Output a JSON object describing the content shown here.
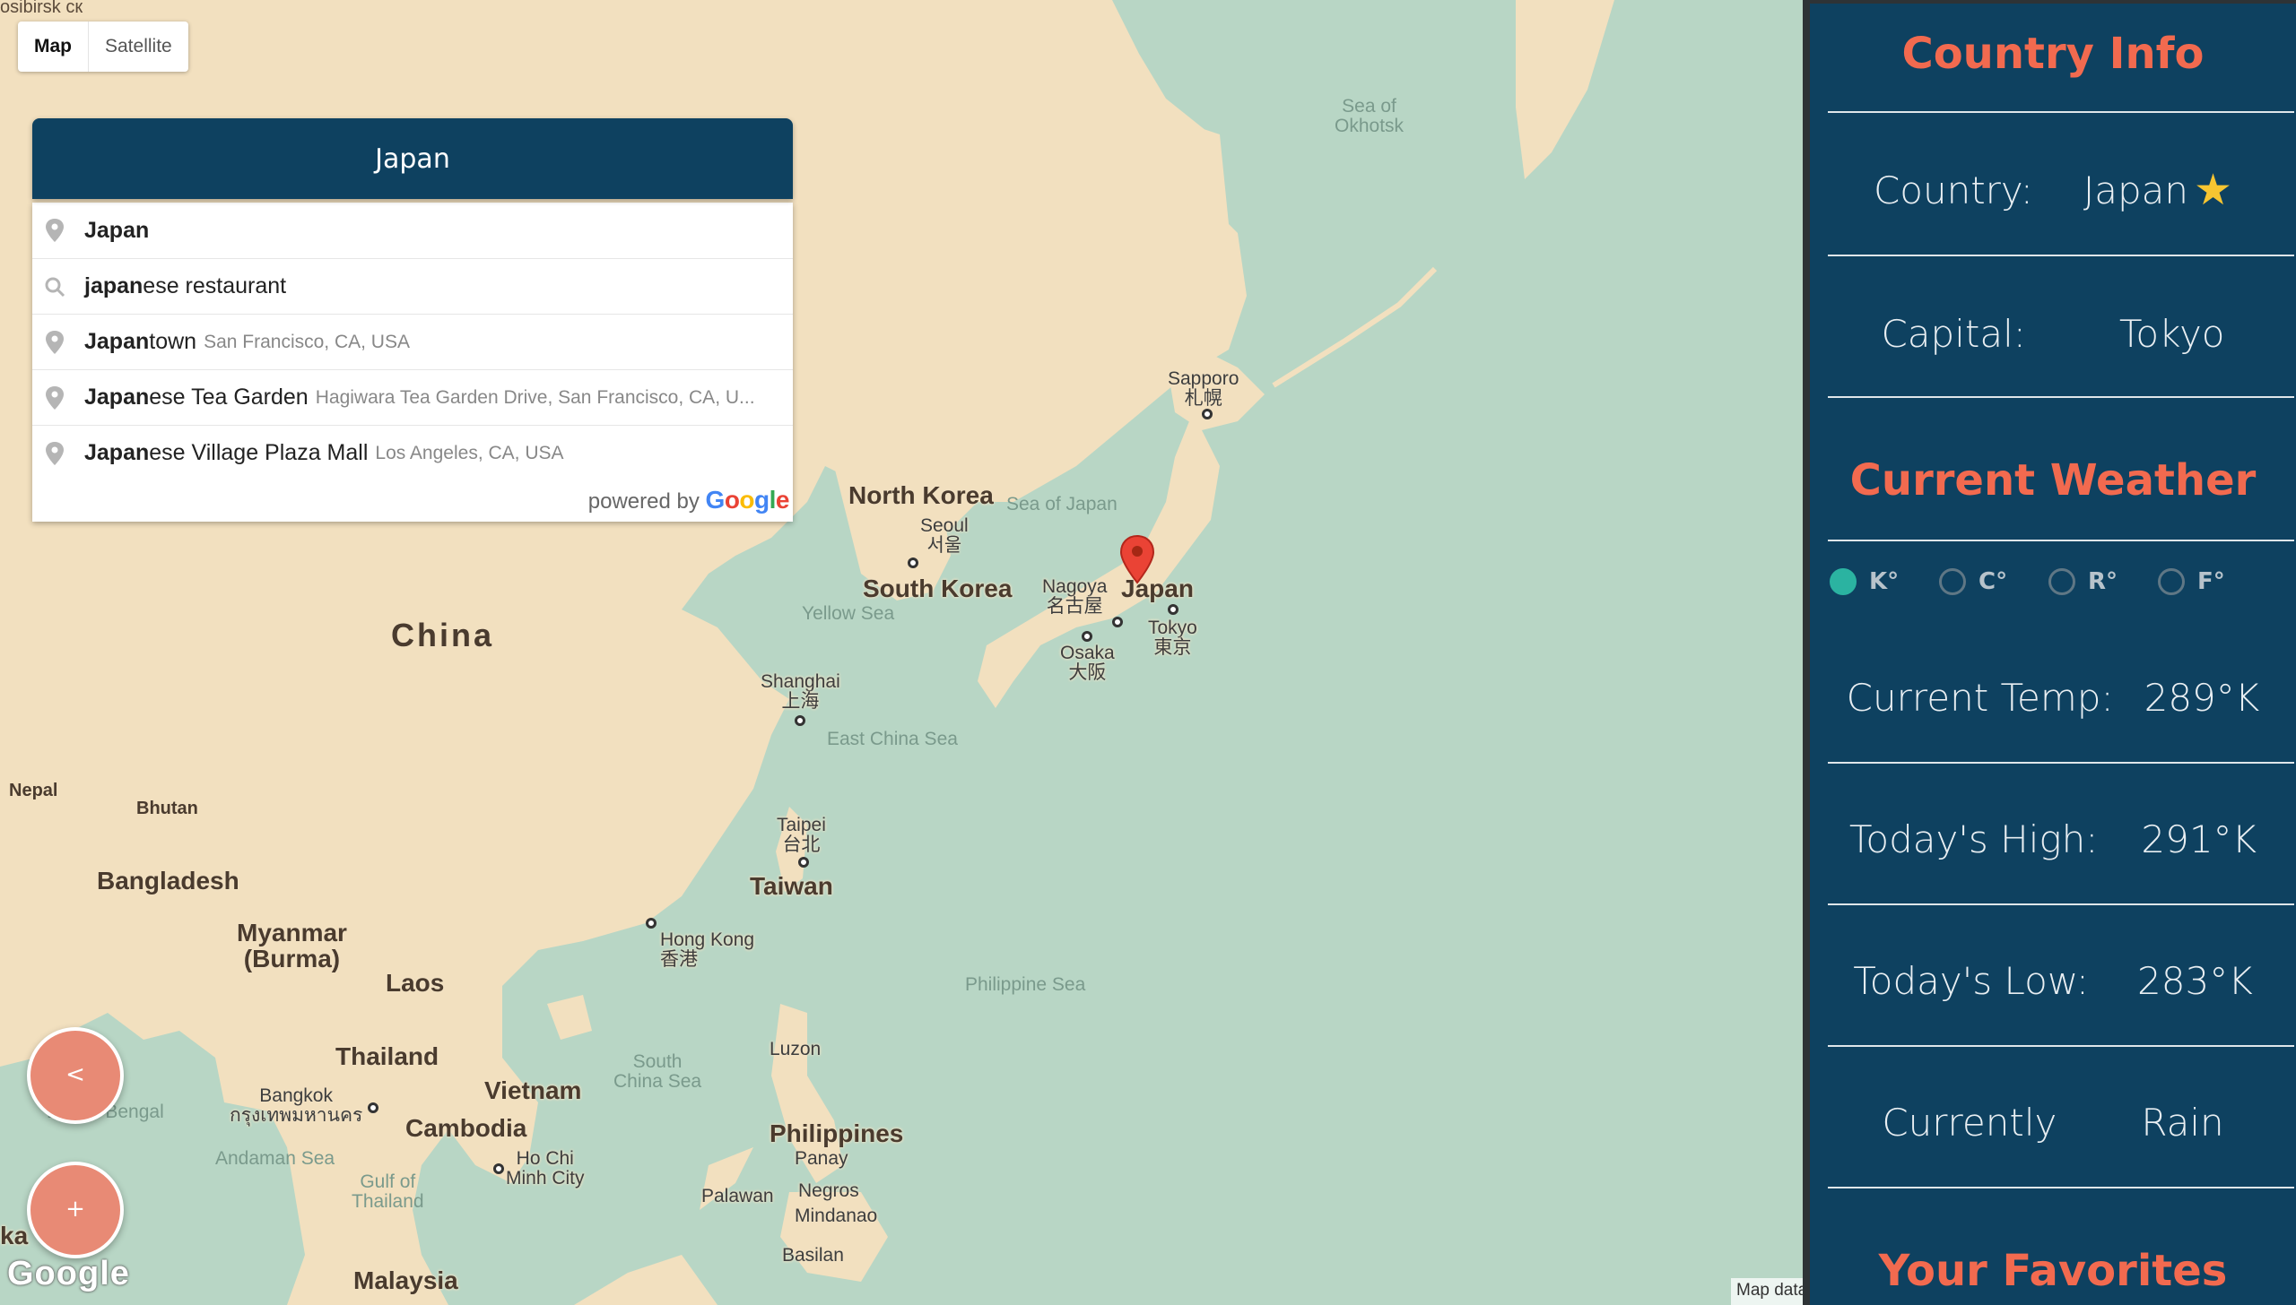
{
  "map": {
    "type_controls": {
      "map": "Map",
      "satellite": "Satellite"
    },
    "labels": {
      "sea_of_okhotsk": "Sea of\nOkhotsk",
      "sapporo": "Sapporo\n札幌",
      "north_korea": "North Korea",
      "sea_of_japan": "Sea of Japan",
      "seoul": "Seoul\n서울",
      "south_korea": "South Korea",
      "yellow_sea": "Yellow Sea",
      "nagoya": "Nagoya\n名古屋",
      "japan": "Japan",
      "tokyo": "Tokyo\n東京",
      "osaka": "Osaka\n大阪",
      "china": "China",
      "shanghai": "Shanghai\n上海",
      "east_china_sea": "East China Sea",
      "nepal": "Nepal",
      "bhutan": "Bhutan",
      "taipei": "Taipei\n台北",
      "taiwan": "Taiwan",
      "bangladesh": "Bangladesh",
      "hong_kong": "Hong Kong\n香港",
      "myanmar": "Myanmar\n(Burma)",
      "laos": "Laos",
      "philippine_sea": "Philippine Sea",
      "thailand": "Thailand",
      "south_china_sea": "South\nChina Sea",
      "luzon": "Luzon",
      "bangkok": "Bangkok\nกรุงเทพมหานคร",
      "vietnam": "Vietnam",
      "bay_of_bengal": "Bay of Bengal",
      "cambodia": "Cambodia",
      "philippines": "Philippines",
      "andaman_sea": "Andaman Sea",
      "gulf_of_thailand": "Gulf of\nThailand",
      "ho_chi_minh": "Ho Chi\nMinh City",
      "panay": "Panay",
      "palawan": "Palawan",
      "negros": "Negros",
      "mindanao": "Mindanao",
      "basilan": "Basilan",
      "malaysia": "Malaysia",
      "top_left_fragment": "osibirsk\nск",
      "sri_lanka_fragment": "ka"
    },
    "google_logo": "Google",
    "map_data": "Map data"
  },
  "search": {
    "value": "Japan",
    "suggestions": [
      {
        "match": "Japan",
        "rest": "",
        "secondary": "",
        "icon": "pin-icon"
      },
      {
        "match": "japan",
        "rest": "ese restaurant",
        "secondary": "",
        "icon": "search-icon"
      },
      {
        "match": "Japan",
        "rest": "town",
        "secondary": "San Francisco, CA, USA",
        "icon": "pin-icon"
      },
      {
        "match": "Japan",
        "rest": "ese Tea Garden",
        "secondary": "Hagiwara Tea Garden Drive, San Francisco, CA, U...",
        "icon": "pin-icon"
      },
      {
        "match": "Japan",
        "rest": "ese Village Plaza Mall",
        "secondary": "Los Angeles, CA, USA",
        "icon": "pin-icon"
      }
    ],
    "powered_by": "powered by",
    "powered_brand": "Google"
  },
  "buttons": {
    "back": "<",
    "add": "+"
  },
  "sidebar": {
    "country_info_title": "Country Info",
    "country_label": "Country:",
    "country_value": "Japan",
    "capital_label": "Capital:",
    "capital_value": "Tokyo",
    "weather_title": "Current Weather",
    "units": [
      {
        "label": "K°",
        "selected": true
      },
      {
        "label": "C°",
        "selected": false
      },
      {
        "label": "R°",
        "selected": false
      },
      {
        "label": "F°",
        "selected": false
      }
    ],
    "current_temp_label": "Current Temp:",
    "current_temp_value": "289°K",
    "high_label": "Today's High:",
    "high_value": "291°K",
    "low_label": "Today's Low:",
    "low_value": "283°K",
    "currently_label": "Currently",
    "currently_value": "Rain",
    "favorites_title": "Your Favorites"
  },
  "colors": {
    "panel": "#0e4160",
    "heading_accent": "#f26a4f",
    "fab": "#e88a75",
    "radio_selected": "#2bb3a1",
    "star": "#f7c531",
    "land": "#f2e0bf",
    "water": "#b8d6c5"
  }
}
